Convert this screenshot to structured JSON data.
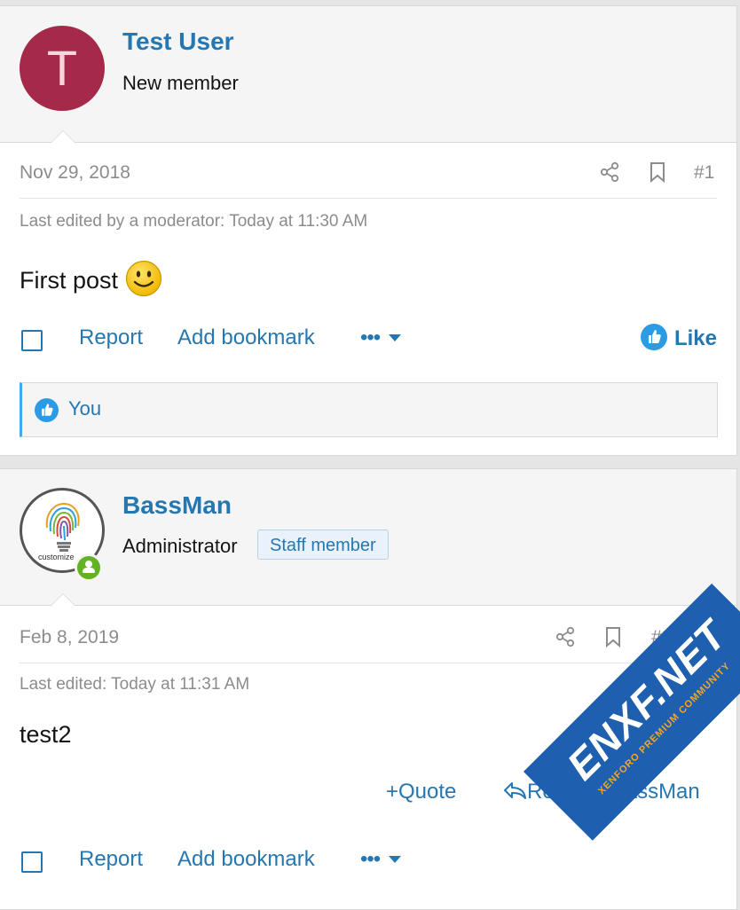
{
  "posts": [
    {
      "avatar_letter": "T",
      "username": "Test User",
      "user_title": "New member",
      "date": "Nov 29, 2018",
      "post_number": "#1",
      "edited": "Last edited by a moderator: Today at 11:30 AM",
      "message": "First post",
      "actions": {
        "report": "Report",
        "bookmark": "Add bookmark",
        "more": "•••",
        "like": "Like"
      },
      "reactions": {
        "user": "You"
      }
    },
    {
      "avatar_caption": "customize",
      "username": "BassMan",
      "user_title": "Administrator",
      "badge": "Staff member",
      "date": "Feb 8, 2019",
      "post_number": "#2",
      "edited": "Last edited: Today at 11:31 AM",
      "message": "test2",
      "quote_actions": {
        "quote": "Quote",
        "reply": "Reply to BassMan"
      },
      "actions": {
        "report": "Report",
        "bookmark": "Add bookmark",
        "more": "•••"
      }
    }
  ],
  "watermark": {
    "text": "ENXF.NET",
    "subtext": "XENFORO PREMIUM COMMUNITY"
  },
  "colors": {
    "accent": "#2577b1",
    "avatar_bg": "#a52a4a",
    "like": "#2c9be6",
    "online": "#63b221"
  }
}
